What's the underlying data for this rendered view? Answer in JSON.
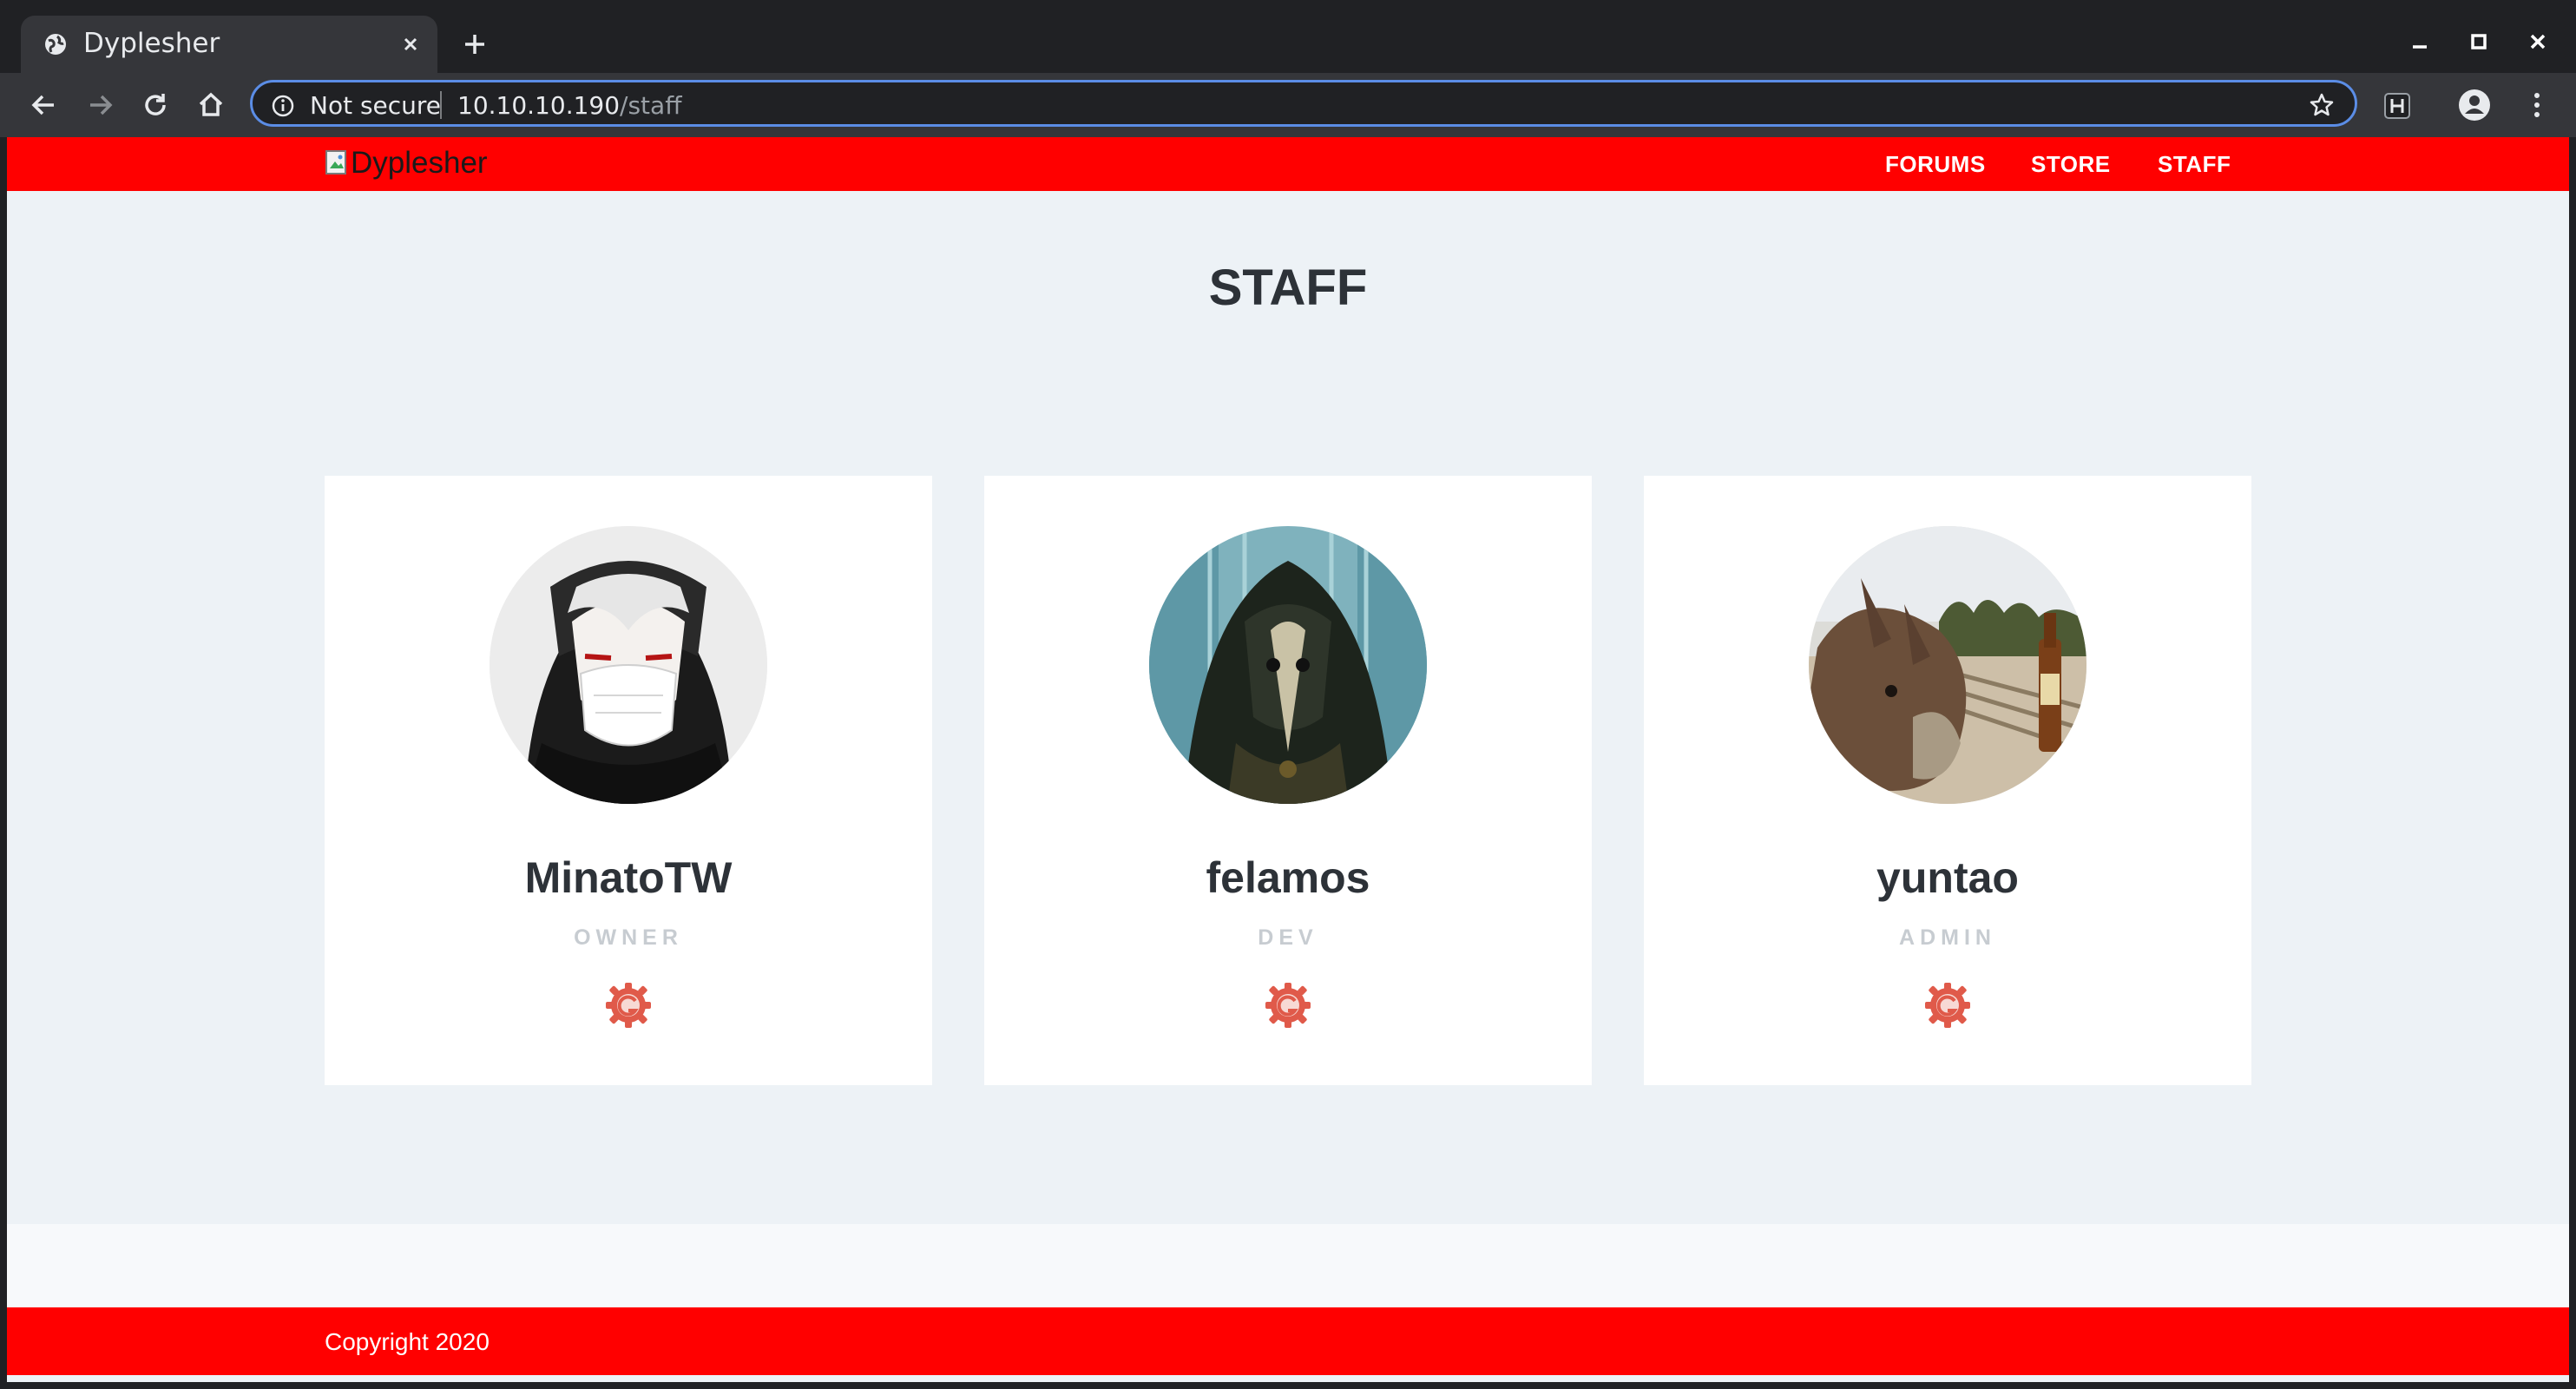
{
  "browser": {
    "tab_title": "Dyplesher",
    "security_label": "Not secure",
    "url_host": "10.10.10.190",
    "url_path": "/staff"
  },
  "site": {
    "brand_alt": "Dyplesher",
    "nav": [
      "FORUMS",
      "STORE",
      "STAFF"
    ],
    "page_title": "STAFF",
    "copyright": "Copyright 2020"
  },
  "staff": [
    {
      "name": "MinatoTW",
      "role": "OWNER",
      "icon": "gitlab-gear-icon"
    },
    {
      "name": "felamos",
      "role": "DEV",
      "icon": "gitlab-gear-icon"
    },
    {
      "name": "yuntao",
      "role": "ADMIN",
      "icon": "gitlab-gear-icon"
    }
  ],
  "colors": {
    "header": "#ff0000",
    "footer": "#ff0000",
    "page_bg": "#edf2f6",
    "card_bg": "#ffffff",
    "role_text": "#c7ccd1",
    "icon_red": "#e05a4a"
  }
}
